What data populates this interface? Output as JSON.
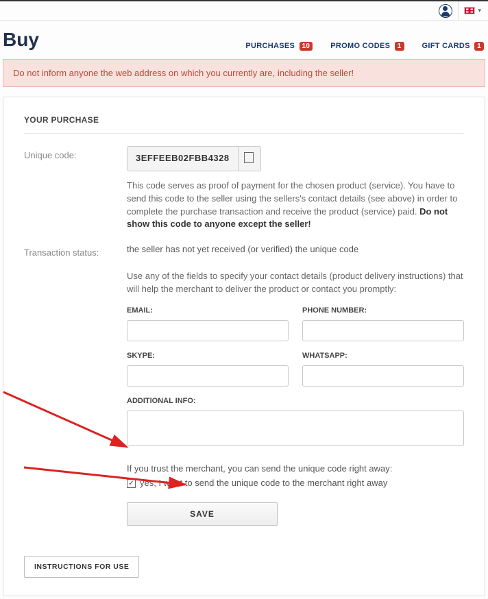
{
  "topbar": {
    "lang": "en"
  },
  "header": {
    "title": "Buy",
    "tabs": [
      {
        "label": "PURCHASES",
        "badge": "10"
      },
      {
        "label": "PROMO CODES",
        "badge": "1"
      },
      {
        "label": "GIFT CARDS",
        "badge": "1"
      }
    ]
  },
  "warning": "Do not inform anyone the web address on which you currently are, including the seller!",
  "purchase": {
    "section_title": "YOUR PURCHASE",
    "code_label": "Unique code:",
    "code_value": "3EFFEEB02FBB4328",
    "code_desc_1": "This code serves as proof of payment for the chosen product (service). You have to send this code to the seller using the sellers's contact details (see above) in order to complete the purchase transaction and receive the product (service) paid. ",
    "code_desc_bold": "Do not show this code to anyone except the seller!",
    "status_label": "Transaction status:",
    "status_value": "the seller has not yet received (or verified) the unique code",
    "contact_hint": "Use any of the fields to specify your contact details (product delivery instructions) that will help the merchant to deliver the product or contact you promptly:",
    "fields": {
      "email": "EMAIL:",
      "phone": "PHONE NUMBER:",
      "skype": "SKYPE:",
      "whatsapp": "WHATSAPP:",
      "additional": "ADDITIONAL INFO:"
    },
    "trust_text": "If you trust the merchant, you can send the unique code right away:",
    "trust_checkbox_label": "yes, I want to send the unique code to the merchant right away",
    "save_label": "SAVE",
    "instructions_label": "INSTRUCTIONS FOR USE"
  }
}
